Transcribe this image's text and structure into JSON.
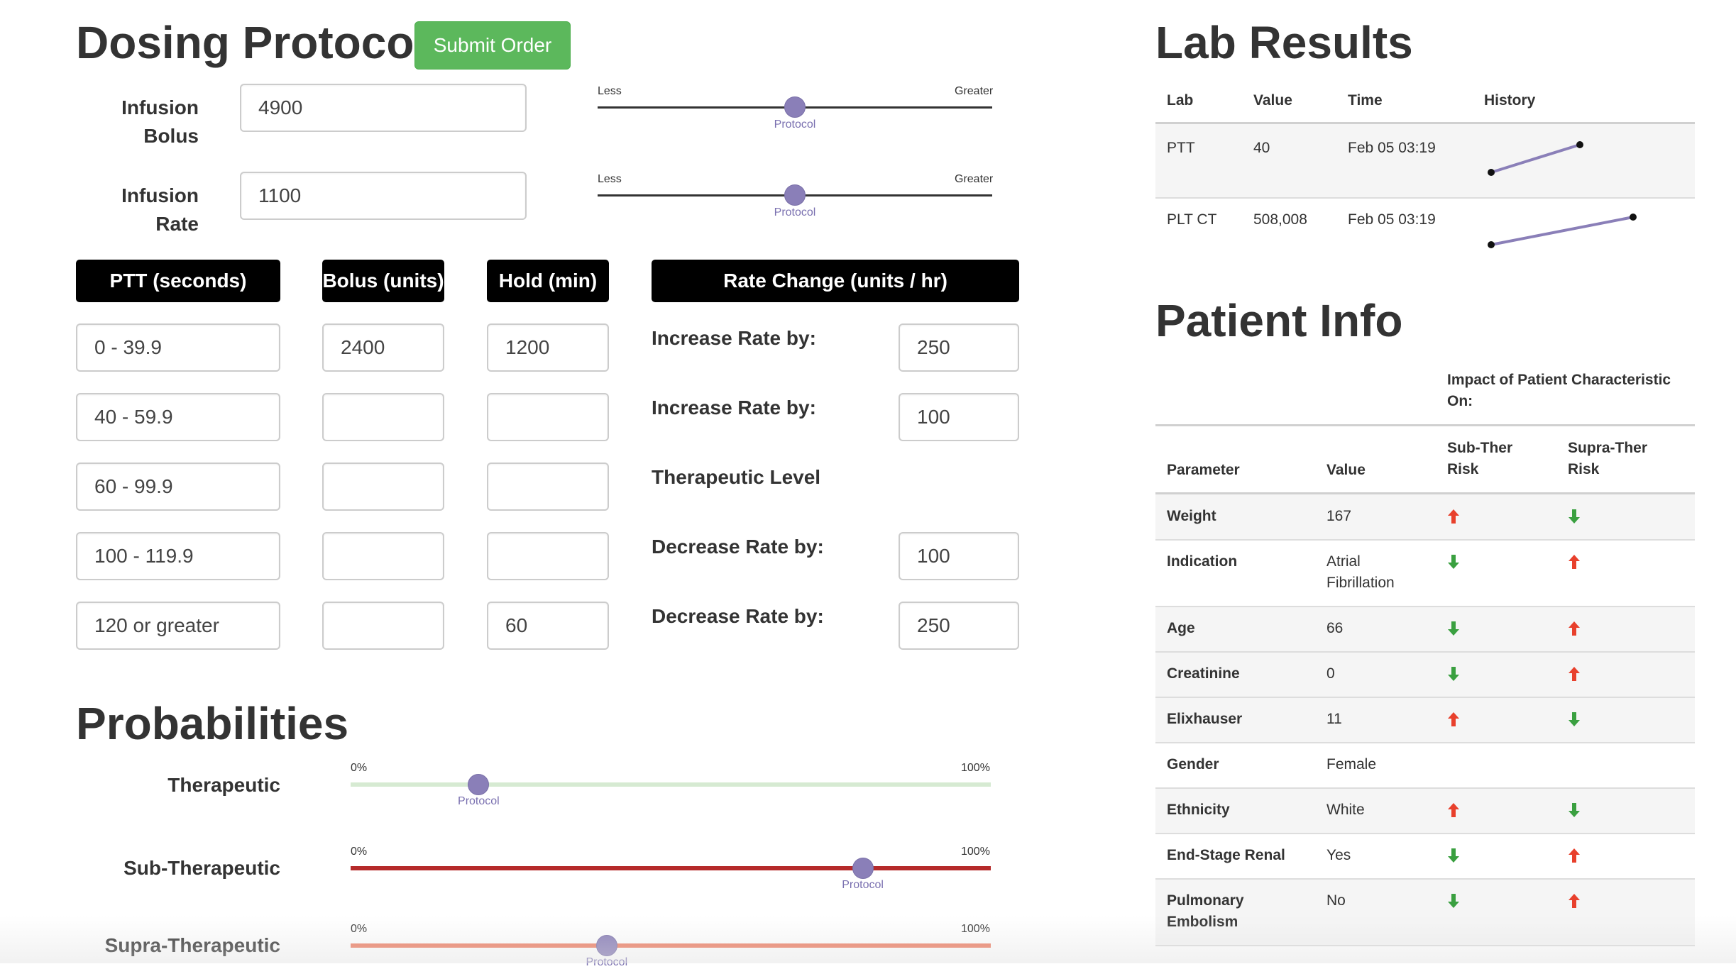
{
  "dosing": {
    "title": "Dosing Protocol",
    "submit_label": "Submit Order",
    "infusion_bolus": {
      "label_line1": "Infusion",
      "label_line2": "Bolus",
      "value": "4900"
    },
    "infusion_rate": {
      "label_line1": "Infusion",
      "label_line2": "Rate",
      "value": "1100"
    },
    "slider_less": "Less",
    "slider_greater": "Greater",
    "slider_marker": "Protocol",
    "headers": {
      "ptt": "PTT (seconds)",
      "bolus": "Bolus (units)",
      "hold": "Hold (min)",
      "rate_change": "Rate Change (units / hr)"
    },
    "rows": [
      {
        "ptt": "0 - 39.9",
        "bolus": "2400",
        "hold": "1200",
        "action": "Increase Rate by:",
        "rate": "250"
      },
      {
        "ptt": "40 - 59.9",
        "bolus": "",
        "hold": "",
        "action": "Increase Rate by:",
        "rate": "100"
      },
      {
        "ptt": "60 - 99.9",
        "bolus": "",
        "hold": "",
        "action": "Therapeutic Level",
        "rate": ""
      },
      {
        "ptt": "100 - 119.9",
        "bolus": "",
        "hold": "",
        "action": "Decrease Rate by:",
        "rate": "100"
      },
      {
        "ptt": "120 or greater",
        "bolus": "",
        "hold": "60",
        "action": "Decrease Rate by:",
        "rate": "250"
      }
    ]
  },
  "probabilities": {
    "title": "Probabilities",
    "min_label": "0%",
    "max_label": "100%",
    "marker": "Protocol",
    "items": [
      {
        "label": "Therapeutic",
        "value": 0.2,
        "color": "#d6ead2"
      },
      {
        "label": "Sub-Therapeutic",
        "value": 0.8,
        "color": "#b52a2a"
      },
      {
        "label": "Supra-Therapeutic",
        "value": 0.4,
        "color": "#ee7f65"
      }
    ]
  },
  "lab_results": {
    "title": "Lab Results",
    "columns": [
      "Lab",
      "Value",
      "Time",
      "History"
    ],
    "rows": [
      {
        "lab": "PTT",
        "value": "40",
        "time": "Feb 05 03:19"
      },
      {
        "lab": "PLT CT",
        "value": "508,008",
        "time": "Feb 05 03:19"
      }
    ]
  },
  "patient_info": {
    "title": "Patient Info",
    "impact_header_line1": "Impact of Patient Characteristic",
    "impact_header_line2": "On:",
    "col_parameter": "Parameter",
    "col_value": "Value",
    "col_sub_line1": "Sub-Ther",
    "col_sub_line2": "Risk",
    "col_supra_line1": "Supra-Ther",
    "col_supra_line2": "Risk",
    "rows": [
      {
        "param": "Weight",
        "value": "167",
        "sub": "up",
        "supra": "down"
      },
      {
        "param": "Indication",
        "value_line1": "Atrial",
        "value_line2": "Fibrillation",
        "sub": "down",
        "supra": "up"
      },
      {
        "param": "Age",
        "value": "66",
        "sub": "down",
        "supra": "up"
      },
      {
        "param": "Creatinine",
        "value": "0",
        "sub": "down",
        "supra": "up"
      },
      {
        "param": "Elixhauser",
        "value": "11",
        "sub": "up",
        "supra": "down"
      },
      {
        "param": "Gender",
        "value": "Female",
        "sub": "",
        "supra": ""
      },
      {
        "param": "Ethnicity",
        "value": "White",
        "sub": "up",
        "supra": "down"
      },
      {
        "param": "End-Stage Renal",
        "value": "Yes",
        "sub": "down",
        "supra": "up"
      },
      {
        "param_line1": "Pulmonary",
        "param_line2": "Embolism",
        "value": "No",
        "sub": "down",
        "supra": "up"
      }
    ]
  },
  "colors": {
    "up": "#e8402c",
    "down": "#3aa040",
    "knob": "#8a7fb8",
    "submit": "#5cb85c"
  }
}
